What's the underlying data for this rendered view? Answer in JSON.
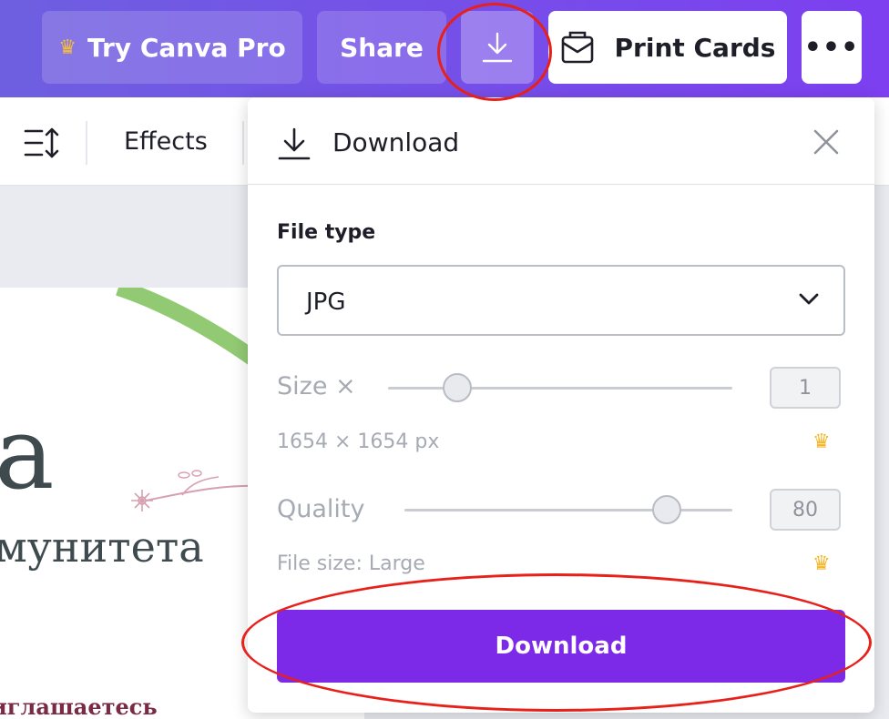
{
  "topbar": {
    "try_pro_label": "Try Canva Pro",
    "share_label": "Share",
    "print_label": "Print Cards",
    "more_label": "•••"
  },
  "toolbar": {
    "effects_label": "Effects"
  },
  "canvas": {
    "text_big": "а",
    "text_line2": "мунитета",
    "text_line3": "иглашаетесь"
  },
  "download_panel": {
    "title": "Download",
    "file_type_label": "File type",
    "file_type_value": "JPG",
    "size_label": "Size ×",
    "size_value": "1",
    "size_level": 0.2,
    "dimensions": "1654 × 1654 px",
    "quality_label": "Quality",
    "quality_value": "80",
    "quality_level": 0.8,
    "file_size": "File size: Large",
    "download_button": "Download"
  },
  "colors": {
    "brand_purple": "#7d2ae8",
    "highlight_red": "#e8201a",
    "crown_gold": "#f5b523"
  }
}
